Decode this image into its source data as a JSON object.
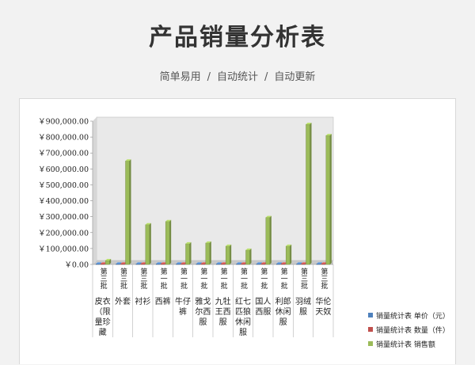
{
  "header": {
    "title": "产品销量分析表",
    "subtitle_items": [
      "简单易用",
      "自动统计",
      "自动更新"
    ],
    "separator": "/"
  },
  "chart_data": {
    "type": "bar",
    "ylim": [
      0,
      900000
    ],
    "yticks": [
      0,
      100000,
      200000,
      300000,
      400000,
      500000,
      600000,
      700000,
      800000,
      900000
    ],
    "ytick_labels": [
      "￥0.00",
      "￥100,000.00",
      "￥200,000.00",
      "￥300,000.00",
      "￥400,000.00",
      "￥500,000.00",
      "￥600,000.00",
      "￥700,000.00",
      "￥800,000.00",
      "￥900,000.00"
    ],
    "grid": false,
    "legend_position": "right",
    "categories": [
      {
        "period": "第三批",
        "name": "皮衣（限量珍藏"
      },
      {
        "period": "第三批",
        "name": "外套"
      },
      {
        "period": "第三批",
        "name": "衬衫"
      },
      {
        "period": "第一批",
        "name": "西裤"
      },
      {
        "period": "第一批",
        "name": "牛仔裤"
      },
      {
        "period": "第一批",
        "name": "雅戈尔西服"
      },
      {
        "period": "第一批",
        "name": "九牡王西服"
      },
      {
        "period": "第一批",
        "name": "红七匹狼休闲服"
      },
      {
        "period": "第一批",
        "name": "国人西服"
      },
      {
        "period": "第一批",
        "name": "利郎休闲服"
      },
      {
        "period": "第三批",
        "name": "羽绒服"
      },
      {
        "period": "第三批",
        "name": "华伦天奴"
      }
    ],
    "series": [
      {
        "name": "销量统计表 单价（元）",
        "color": "#4f81bd",
        "values": [
          1500,
          900,
          400,
          450,
          300,
          1200,
          1100,
          800,
          1000,
          700,
          1600,
          1800
        ]
      },
      {
        "name": "销量统计表 数量（件）",
        "color": "#c0504d",
        "values": [
          15,
          700,
          600,
          590,
          400,
          110,
          100,
          110,
          290,
          160,
          550,
          450
        ]
      },
      {
        "name": "销量统计表 销售额",
        "color": "#9bbb59",
        "values": [
          25000,
          650000,
          250000,
          270000,
          130000,
          135000,
          115000,
          90000,
          295000,
          115000,
          880000,
          810000
        ]
      }
    ]
  }
}
